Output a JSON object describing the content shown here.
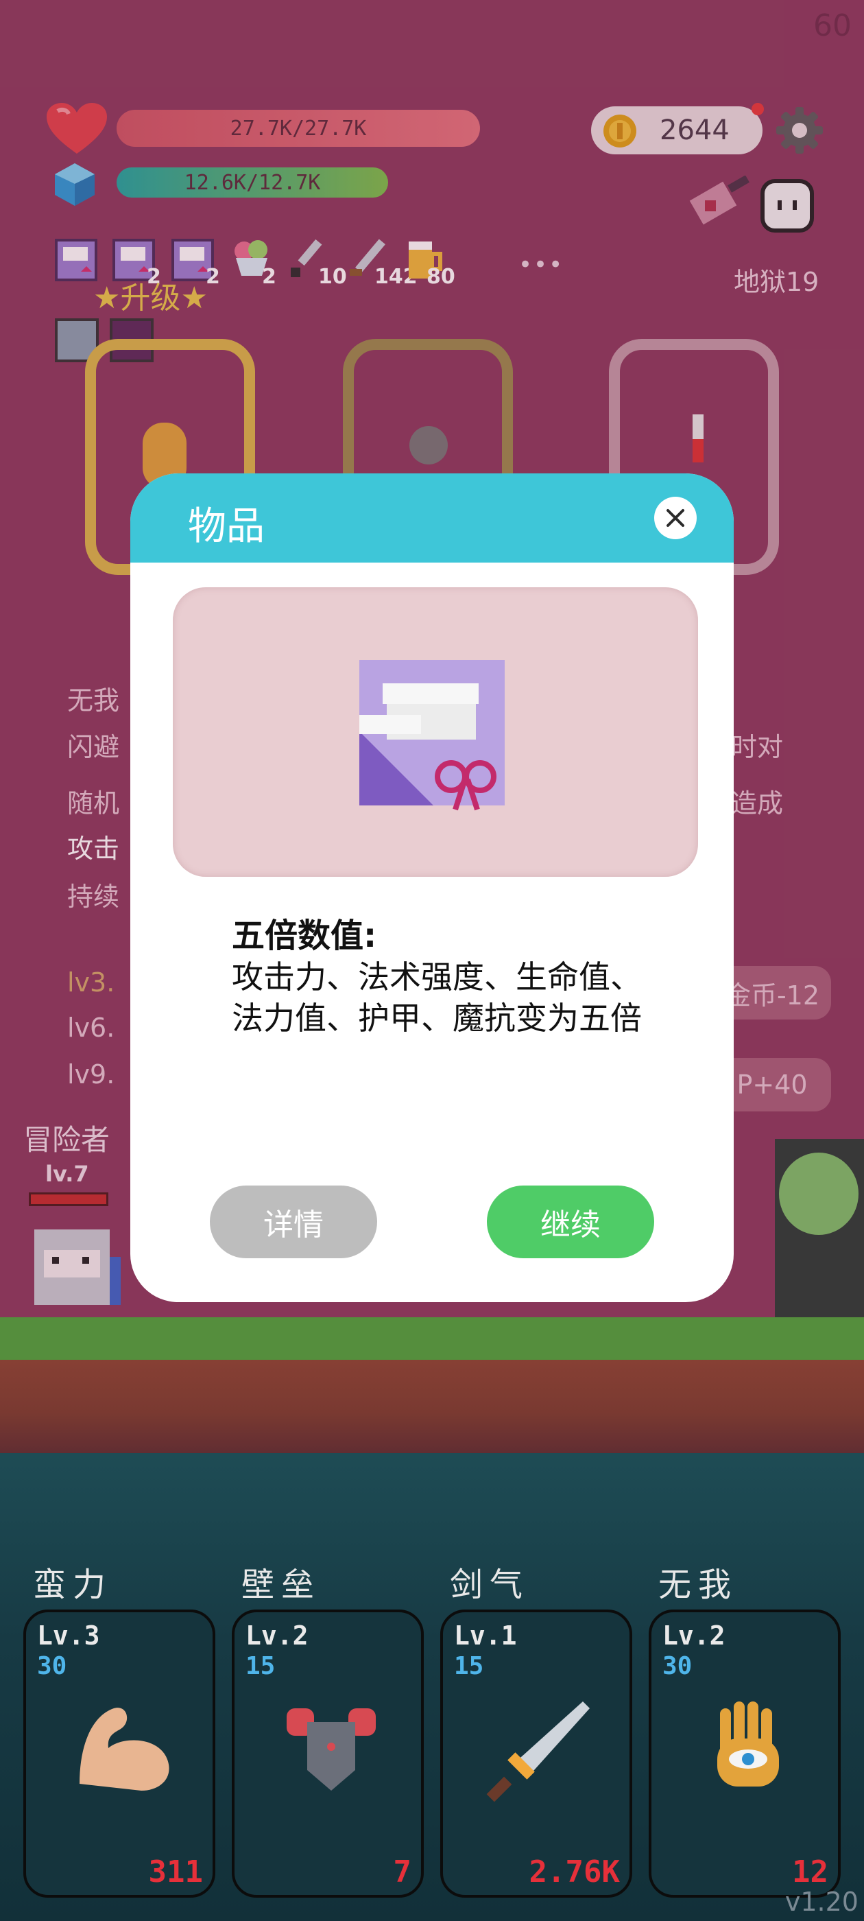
{
  "fps": "60",
  "hud": {
    "hp_text": "27.7K/27.7K",
    "mp_text": "12.6K/12.7K",
    "gold": "2644",
    "stage": "地狱19",
    "upgrade_label": "★升级★",
    "more_label": "•••"
  },
  "inventory": [
    {
      "icon": "scroll-icon",
      "count": ""
    },
    {
      "icon": "scroll-icon",
      "count": "2"
    },
    {
      "icon": "scroll-icon",
      "count": "2"
    },
    {
      "icon": "ice-cream-icon",
      "count": "2"
    },
    {
      "icon": "dagger-icon",
      "count": "10"
    },
    {
      "icon": "sword-icon",
      "count": "142"
    },
    {
      "icon": "beer-icon",
      "count": "80"
    }
  ],
  "background_text": {
    "line1": "无我",
    "line2": "闪避",
    "line3": "随机",
    "line4": "攻击",
    "line5": "持续",
    "right1": "时对",
    "right2": "造成",
    "lv3": "lv3.",
    "lv6": "lv6.",
    "lv9": "lv9.",
    "pill1": "金币-12",
    "pill2": "P+40"
  },
  "player": {
    "name": "冒险者",
    "level": "lv.7"
  },
  "modal": {
    "title": "物品",
    "close_icon": "close-icon",
    "item_icon": "scroll-ribbon-icon",
    "desc_title": "五倍数值:",
    "desc_body": "攻击力、法术强度、生命值、法力值、护甲、魔抗变为五倍",
    "details_label": "详情",
    "continue_label": "继续"
  },
  "skills": [
    {
      "name": "蛮力",
      "level": "Lv.3",
      "cost": "30",
      "value": "311",
      "icon": "muscle-arm-icon"
    },
    {
      "name": "壁垒",
      "level": "Lv.2",
      "cost": "15",
      "value": "7",
      "icon": "armor-icon"
    },
    {
      "name": "剑气",
      "level": "Lv.1",
      "cost": "15",
      "value": "2.76K",
      "icon": "sword-icon"
    },
    {
      "name": "无我",
      "level": "Lv.2",
      "cost": "30",
      "value": "12",
      "icon": "eye-hand-icon"
    }
  ],
  "version": "v1.20",
  "colors": {
    "background": "#8c3a5d",
    "modal_header": "#3ec6d8",
    "continue": "#4fcc67",
    "details": "#bdbdbd",
    "skill_value": "#e6303a",
    "skill_cost": "#4fb5ea"
  }
}
